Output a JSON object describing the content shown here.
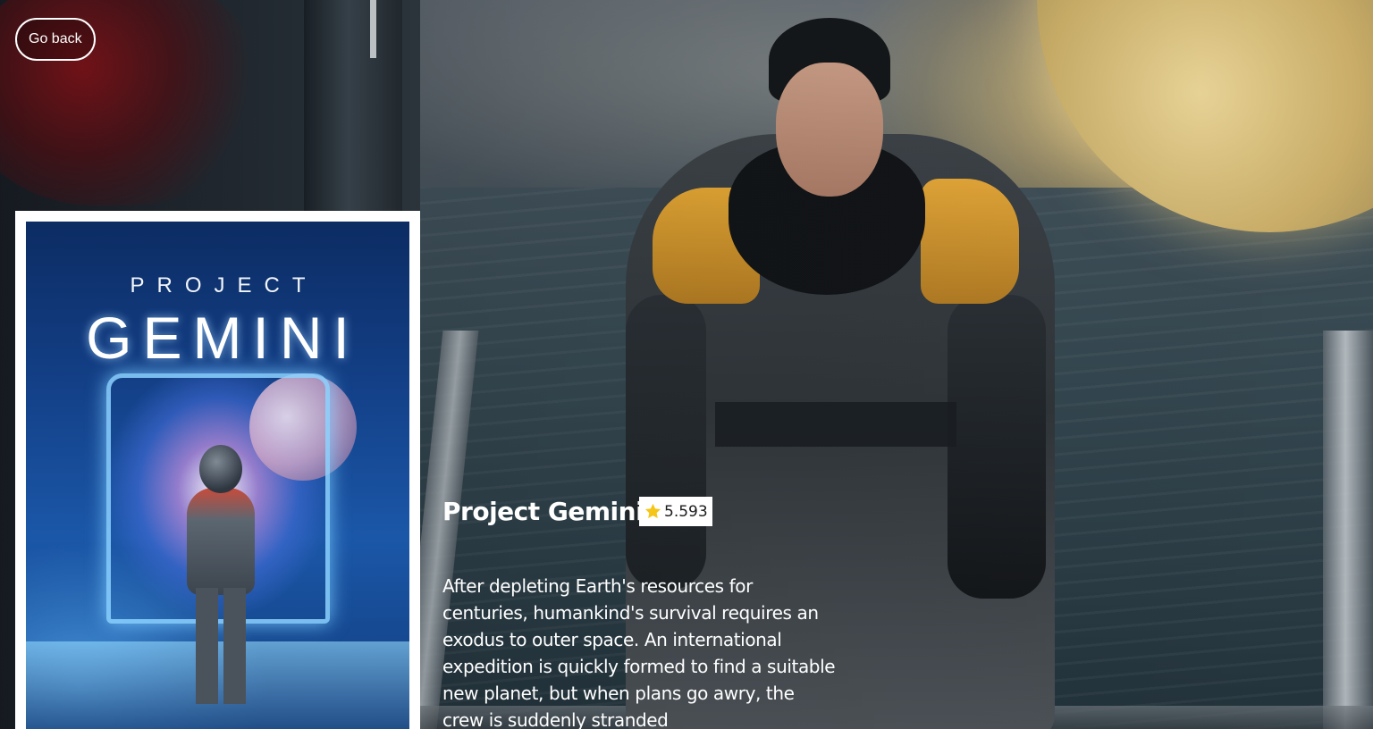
{
  "nav": {
    "back_label": "Go back"
  },
  "movie": {
    "title": "Project Gemini",
    "rating": "5.593",
    "overview": "After depleting Earth's resources for centuries, humankind's survival requires an exodus to outer space. An international expedition is quickly formed to find a suitable new planet, but when plans go awry, the crew is suddenly stranded"
  },
  "poster": {
    "kicker": "PROJECT",
    "title": "GEMINI"
  },
  "icons": {
    "rating": "star-icon"
  },
  "colors": {
    "badge_background": "#ffffff",
    "star": "#f5c518",
    "text": "#ffffff"
  }
}
